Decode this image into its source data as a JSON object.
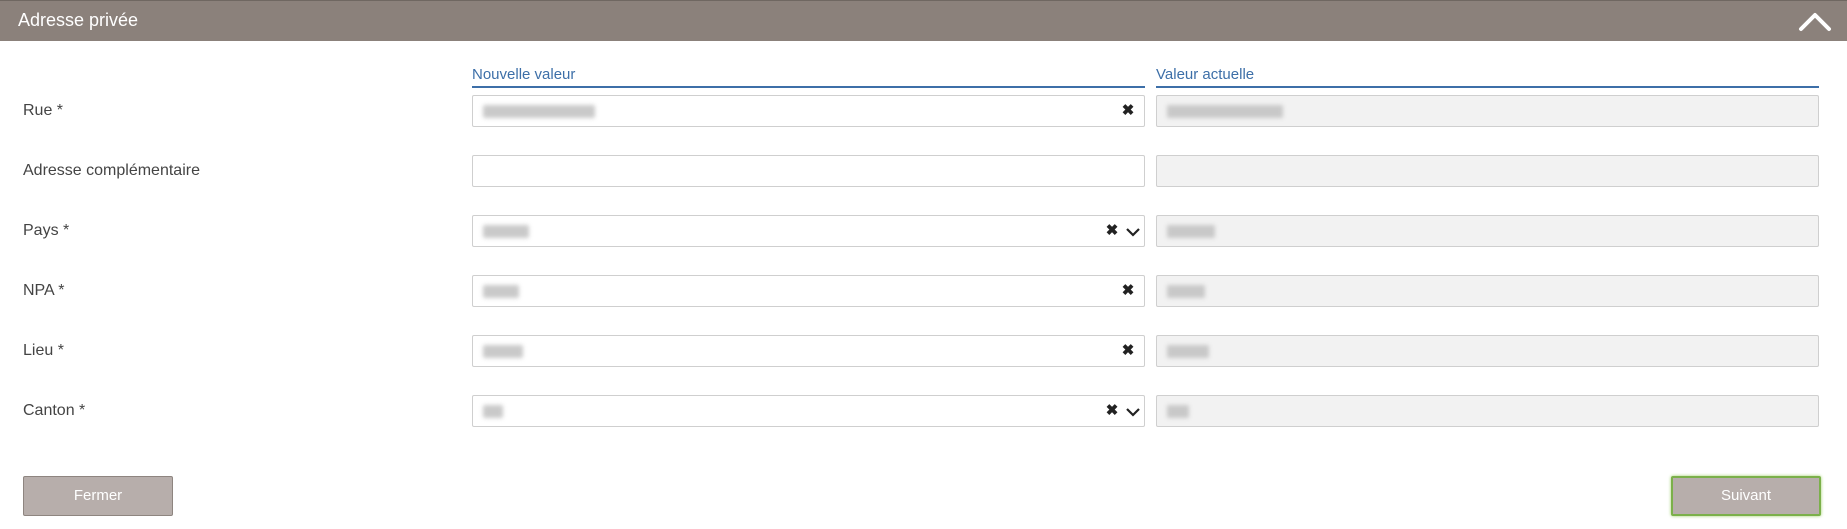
{
  "panel": {
    "title": "Adresse privée",
    "collapse_icon": "chevron-up-icon"
  },
  "columns": {
    "new_label": "Nouvelle valeur",
    "current_label": "Valeur actuelle"
  },
  "rows": [
    {
      "label": "Rue *",
      "type": "text",
      "new_value": "",
      "current_value": "",
      "clear": true,
      "dropdown": false
    },
    {
      "label": "Adresse complémentaire",
      "type": "text",
      "new_value": "",
      "current_value": "",
      "clear": false,
      "dropdown": false
    },
    {
      "label": "Pays *",
      "type": "select",
      "new_value": "",
      "current_value": "",
      "clear": true,
      "dropdown": true
    },
    {
      "label": "NPA *",
      "type": "text",
      "new_value": "",
      "current_value": "",
      "clear": true,
      "dropdown": false
    },
    {
      "label": "Lieu *",
      "type": "text",
      "new_value": "",
      "current_value": "",
      "clear": true,
      "dropdown": false
    },
    {
      "label": "Canton *",
      "type": "select",
      "new_value": "",
      "current_value": "",
      "clear": true,
      "dropdown": true
    }
  ],
  "buttons": {
    "close_label": "Fermer",
    "next_label": "Suivant"
  },
  "colors": {
    "header_bg": "#8b817b",
    "column_header": "#3d6fa8",
    "button_bg": "#b7aeab",
    "focus_outline": "#7bb04a"
  }
}
